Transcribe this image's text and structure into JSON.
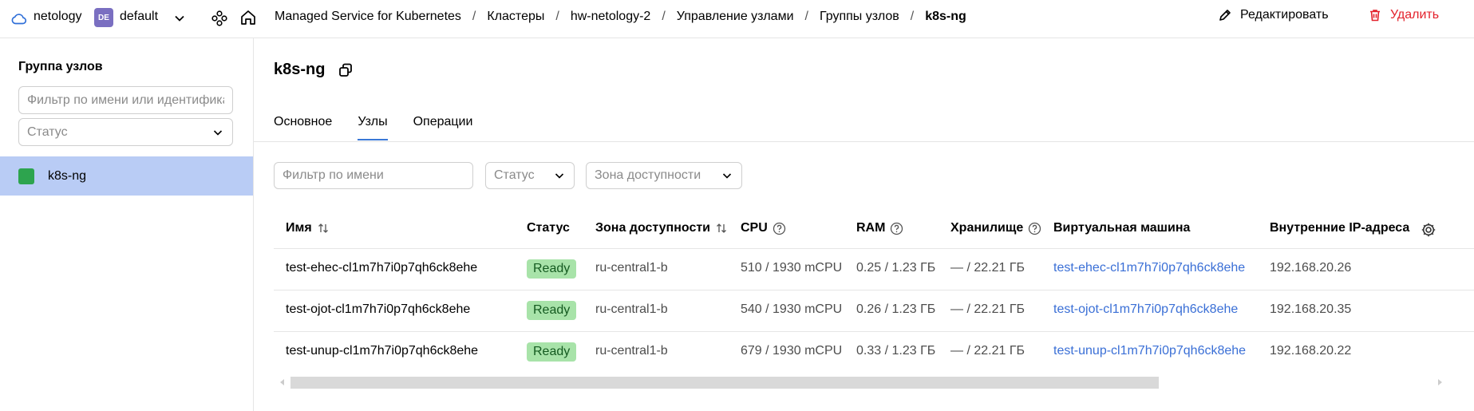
{
  "topbar": {
    "cloud_name": "netology",
    "folder_badge": "DE",
    "folder_name": "default",
    "breadcrumbs": [
      "Managed Service for Kubernetes",
      "Кластеры",
      "hw-netology-2",
      "Управление узлами",
      "Группы узлов",
      "k8s-ng"
    ],
    "edit_label": "Редактировать",
    "delete_label": "Удалить"
  },
  "left": {
    "title": "Группа узлов",
    "filter_placeholder": "Фильтр по имени или идентификатору",
    "status_placeholder": "Статус",
    "items": [
      {
        "label": "k8s-ng",
        "status_color": "#2da44e"
      }
    ]
  },
  "main": {
    "title": "k8s-ng",
    "tabs": [
      {
        "label": "Основное",
        "active": false
      },
      {
        "label": "Узлы",
        "active": true
      },
      {
        "label": "Операции",
        "active": false
      }
    ],
    "filter_placeholder": "Фильтр по имени",
    "status_select": "Статус",
    "zone_select": "Зона доступности"
  },
  "table": {
    "columns": [
      "Имя",
      "Статус",
      "Зона доступности",
      "CPU",
      "RAM",
      "Хранилище",
      "Виртуальная машина",
      "Внутренние IP-адреса"
    ],
    "rows": [
      {
        "name": "test-ehec-cl1m7h7i0p7qh6ck8ehe",
        "status": "Ready",
        "zone": "ru-central1-b",
        "cpu": "510 / 1930 mCPU",
        "ram": "0.25 / 1.23 ГБ",
        "storage": "— / 22.21 ГБ",
        "vm": "test-ehec-cl1m7h7i0p7qh6ck8ehe",
        "ip": "192.168.20.26"
      },
      {
        "name": "test-ojot-cl1m7h7i0p7qh6ck8ehe",
        "status": "Ready",
        "zone": "ru-central1-b",
        "cpu": "540 / 1930 mCPU",
        "ram": "0.26 / 1.23 ГБ",
        "storage": "— / 22.21 ГБ",
        "vm": "test-ojot-cl1m7h7i0p7qh6ck8ehe",
        "ip": "192.168.20.35"
      },
      {
        "name": "test-unup-cl1m7h7i0p7qh6ck8ehe",
        "status": "Ready",
        "zone": "ru-central1-b",
        "cpu": "679 / 1930 mCPU",
        "ram": "0.33 / 1.23 ГБ",
        "storage": "— / 22.21 ГБ",
        "vm": "test-unup-cl1m7h7i0p7qh6ck8ehe",
        "ip": "192.168.20.22"
      }
    ]
  },
  "colors": {
    "accent": "#3a78d6",
    "danger": "#e3212b",
    "selected_bg": "#b9ccf5",
    "ready_bg": "#a8e3a9"
  },
  "icons": [
    "cloud-icon",
    "chevron-down-icon",
    "services-icon",
    "home-icon",
    "pencil-icon",
    "trash-icon",
    "copy-icon",
    "sort-icon",
    "help-icon",
    "gear-icon"
  ]
}
